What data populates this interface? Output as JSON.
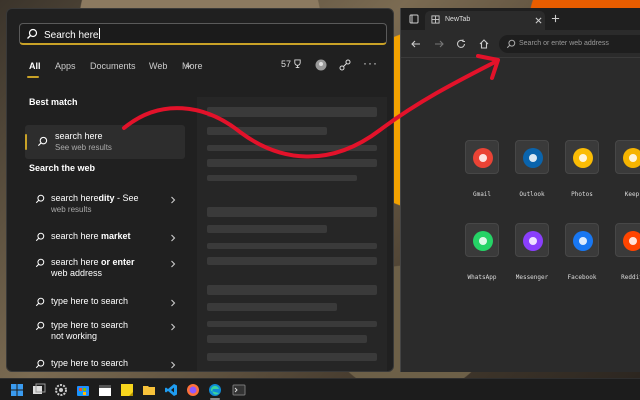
{
  "search": {
    "value": "Search here"
  },
  "tabs": [
    {
      "label": "All"
    },
    {
      "label": "Apps"
    },
    {
      "label": "Documents"
    },
    {
      "label": "Web"
    },
    {
      "label": "More"
    }
  ],
  "rewards_points": "57",
  "sections": {
    "best_match": "Best match",
    "search_web": "Search the web"
  },
  "best_match": {
    "title": "search here",
    "subtitle": "See web results"
  },
  "web_results": [
    {
      "prefix": "search here",
      "bold": "dity",
      "suffix": " - See",
      "line2": "web results"
    },
    {
      "prefix": "search here ",
      "bold": "market",
      "suffix": "",
      "line2": ""
    },
    {
      "prefix": "search here ",
      "bold": "or enter",
      "suffix": "",
      "line2": "web address"
    },
    {
      "prefix": "type here to search",
      "bold": "",
      "suffix": "",
      "line2": ""
    },
    {
      "prefix": "type here to search",
      "bold": "",
      "suffix": "",
      "line2": "not working"
    },
    {
      "prefix": "type here to search",
      "bold": "",
      "suffix": "",
      "line2": "..."
    }
  ],
  "browser": {
    "tab_title": "NewTab",
    "address_placeholder": "Search or enter web address",
    "tiles": [
      {
        "name": "Gmail",
        "icon": "gmail-icon",
        "color": "#ea4335"
      },
      {
        "name": "Outlook",
        "icon": "outlook-icon",
        "color": "#0a64ad"
      },
      {
        "name": "Photos",
        "icon": "photos-icon",
        "color": "#fbbc04"
      },
      {
        "name": "Keep",
        "icon": "keep-icon",
        "color": "#f6b400"
      },
      {
        "name": "WhatsApp",
        "icon": "whatsapp-icon",
        "color": "#25d366"
      },
      {
        "name": "Messenger",
        "icon": "messenger-icon",
        "color": "#8a3ffc"
      },
      {
        "name": "Facebook",
        "icon": "facebook-icon",
        "color": "#1877f2"
      },
      {
        "name": "Reddit",
        "icon": "reddit-icon",
        "color": "#ff4500"
      }
    ]
  },
  "colors": {
    "accent": "#c9a227",
    "arrow": "#e3122a"
  }
}
